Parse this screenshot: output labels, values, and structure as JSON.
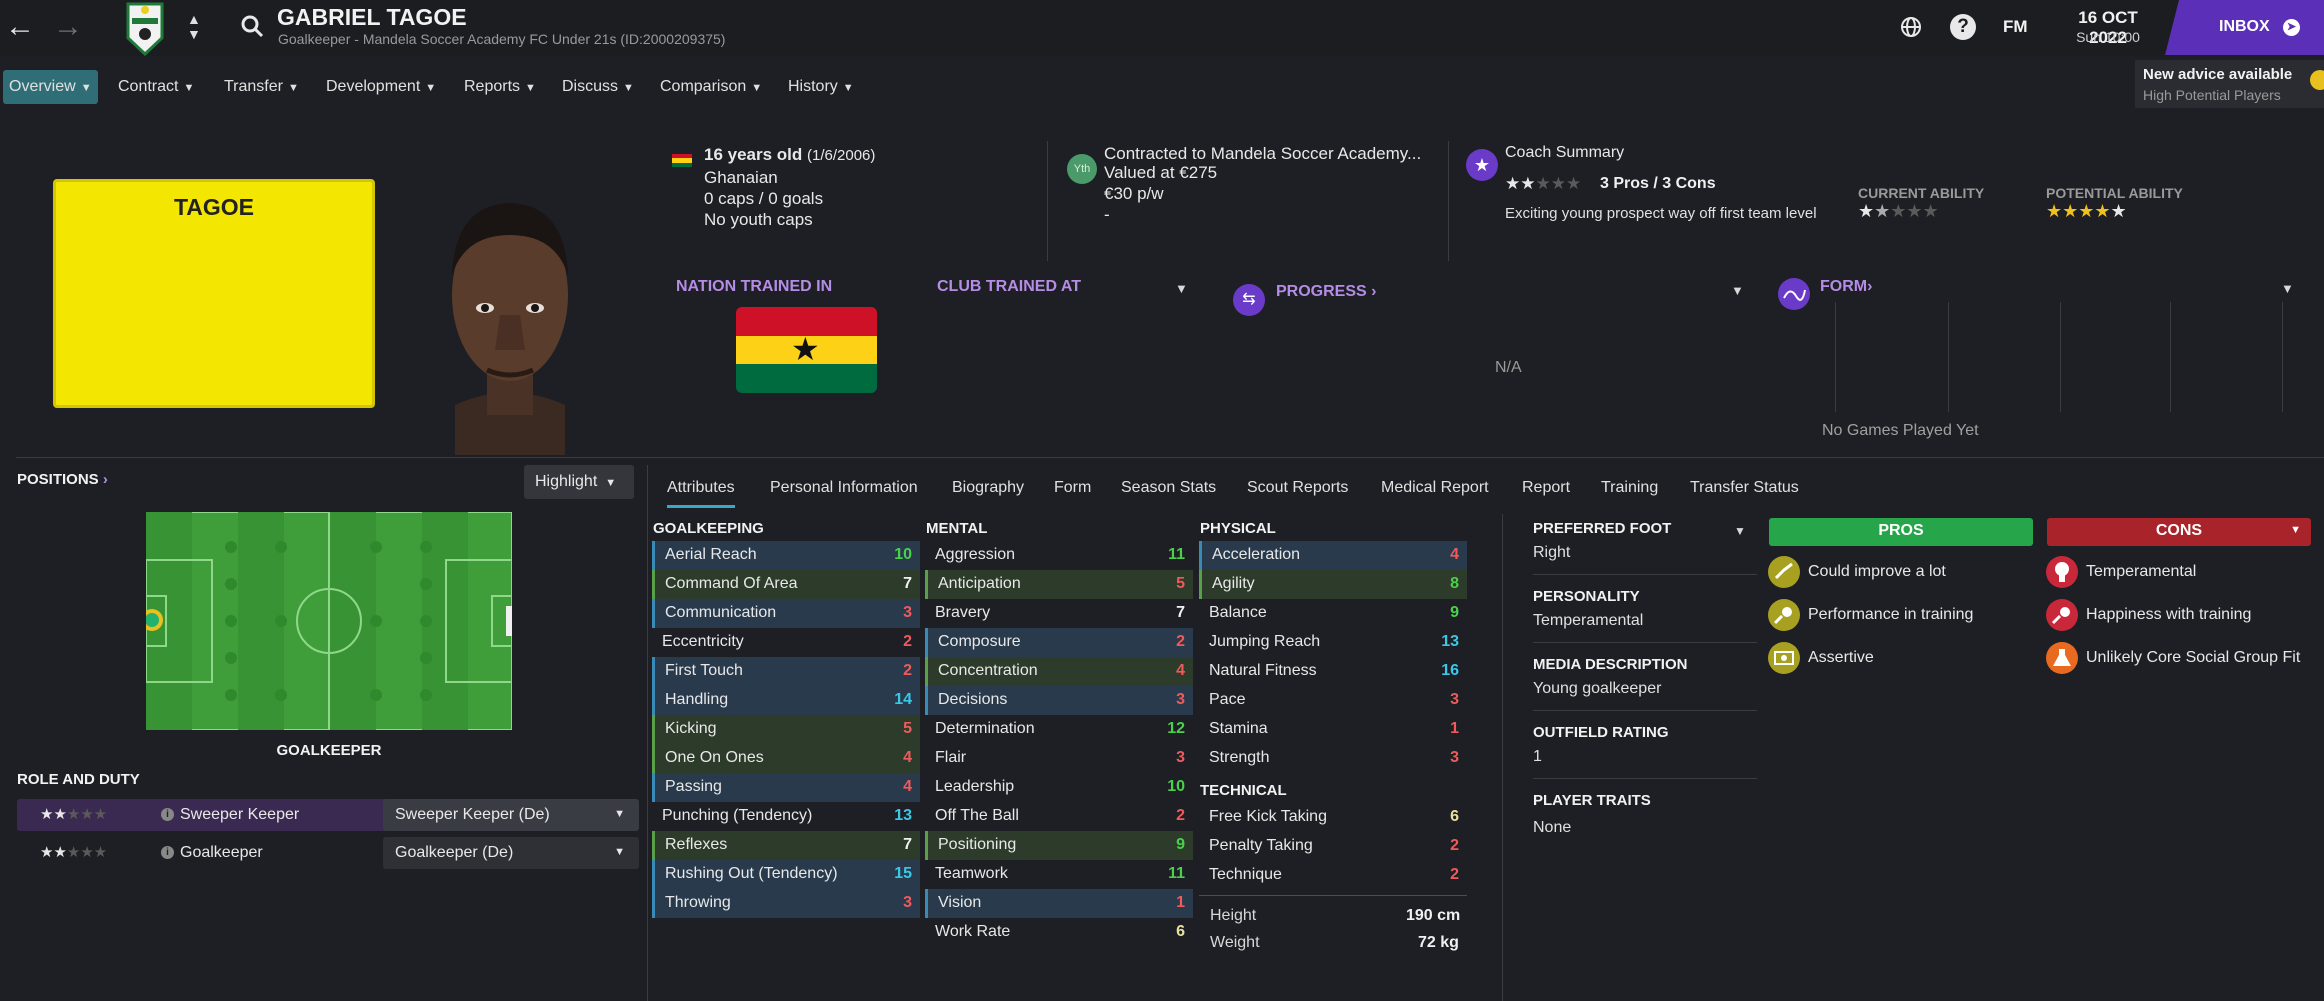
{
  "header": {
    "name": "GABRIEL TAGOE",
    "subtitle": "Goalkeeper - Mandela Soccer Academy FC Under 21s (ID:2000209375)",
    "date": "16 OCT 2022",
    "time": "Sun 10:00",
    "fm_label": "FM",
    "inbox_label": "INBOX",
    "advice_title": "New advice available",
    "advice_sub": "High Potential Players"
  },
  "nav": [
    "Overview",
    "Contract",
    "Transfer",
    "Development",
    "Reports",
    "Discuss",
    "Comparison",
    "History"
  ],
  "kit": {
    "name": "TAGOE"
  },
  "bio": {
    "age": "16 years old",
    "dob": "(1/6/2006)",
    "nationality": "Ghanaian",
    "caps": "0 caps / 0 goals",
    "youth_caps": "No youth caps"
  },
  "contract": {
    "badge": "Yth",
    "line1": "Contracted to Mandela Soccer Academy...",
    "line2": "Valued at €275",
    "line3": "€30 p/w",
    "line4": "-"
  },
  "coach": {
    "title": "Coach Summary",
    "pros_cons": "3 Pros / 3 Cons",
    "summary": "Exciting young prospect way off first team level",
    "stars": 2,
    "current_ability_label": "CURRENT ABILITY",
    "potential_ability_label": "POTENTIAL ABILITY",
    "current_ability": 1.5,
    "potential_ability": 4.5
  },
  "sections": {
    "nation_trained": "NATION TRAINED IN",
    "club_trained": "CLUB TRAINED AT",
    "progress": "PROGRESS",
    "progress_value": "N/A",
    "form": "FORM",
    "form_value": "No Games Played Yet"
  },
  "positions": {
    "label": "POSITIONS",
    "highlight": "Highlight",
    "position_name": "GOALKEEPER",
    "role_duty_label": "ROLE AND DUTY",
    "roles": [
      {
        "name": "Sweeper Keeper",
        "duty": "Sweeper Keeper (De)",
        "stars": 2
      },
      {
        "name": "Goalkeeper",
        "duty": "Goalkeeper (De)",
        "stars": 2
      }
    ]
  },
  "tabs": [
    "Attributes",
    "Personal Information",
    "Biography",
    "Form",
    "Season Stats",
    "Scout Reports",
    "Medical Report",
    "Report",
    "Training",
    "Transfer Status"
  ],
  "attributes": {
    "goalkeeping_label": "GOALKEEPING",
    "mental_label": "MENTAL",
    "physical_label": "PHYSICAL",
    "technical_label": "TECHNICAL",
    "goalkeeping": [
      {
        "name": "Aerial Reach",
        "value": "10",
        "hl": "b"
      },
      {
        "name": "Command Of Area",
        "value": "7",
        "hl": "g"
      },
      {
        "name": "Communication",
        "value": "3",
        "hl": "b"
      },
      {
        "name": "Eccentricity",
        "value": "2",
        "hl": ""
      },
      {
        "name": "First Touch",
        "value": "2",
        "hl": "b"
      },
      {
        "name": "Handling",
        "value": "14",
        "hl": "b"
      },
      {
        "name": "Kicking",
        "value": "5",
        "hl": "g"
      },
      {
        "name": "One On Ones",
        "value": "4",
        "hl": "g"
      },
      {
        "name": "Passing",
        "value": "4",
        "hl": "b"
      },
      {
        "name": "Punching (Tendency)",
        "value": "13",
        "hl": ""
      },
      {
        "name": "Reflexes",
        "value": "7",
        "hl": "g"
      },
      {
        "name": "Rushing Out (Tendency)",
        "value": "15",
        "hl": "b"
      },
      {
        "name": "Throwing",
        "value": "3",
        "hl": "b"
      }
    ],
    "mental": [
      {
        "name": "Aggression",
        "value": "11",
        "hl": ""
      },
      {
        "name": "Anticipation",
        "value": "5",
        "hl": "g"
      },
      {
        "name": "Bravery",
        "value": "7",
        "hl": ""
      },
      {
        "name": "Composure",
        "value": "2",
        "hl": "b"
      },
      {
        "name": "Concentration",
        "value": "4",
        "hl": "g"
      },
      {
        "name": "Decisions",
        "value": "3",
        "hl": "b"
      },
      {
        "name": "Determination",
        "value": "12",
        "hl": ""
      },
      {
        "name": "Flair",
        "value": "3",
        "hl": ""
      },
      {
        "name": "Leadership",
        "value": "10",
        "hl": ""
      },
      {
        "name": "Off The Ball",
        "value": "2",
        "hl": ""
      },
      {
        "name": "Positioning",
        "value": "9",
        "hl": "g"
      },
      {
        "name": "Teamwork",
        "value": "11",
        "hl": ""
      },
      {
        "name": "Vision",
        "value": "1",
        "hl": "b"
      },
      {
        "name": "Work Rate",
        "value": "6",
        "hl": ""
      }
    ],
    "physical": [
      {
        "name": "Acceleration",
        "value": "4",
        "hl": "b"
      },
      {
        "name": "Agility",
        "value": "8",
        "hl": "g"
      },
      {
        "name": "Balance",
        "value": "9",
        "hl": ""
      },
      {
        "name": "Jumping Reach",
        "value": "13",
        "hl": ""
      },
      {
        "name": "Natural Fitness",
        "value": "16",
        "hl": ""
      },
      {
        "name": "Pace",
        "value": "3",
        "hl": ""
      },
      {
        "name": "Stamina",
        "value": "1",
        "hl": ""
      },
      {
        "name": "Strength",
        "value": "3",
        "hl": ""
      }
    ],
    "technical": [
      {
        "name": "Free Kick Taking",
        "value": "6",
        "hl": ""
      },
      {
        "name": "Penalty Taking",
        "value": "2",
        "hl": ""
      },
      {
        "name": "Technique",
        "value": "2",
        "hl": ""
      }
    ],
    "height_label": "Height",
    "height": "190 cm",
    "weight_label": "Weight",
    "weight": "72 kg"
  },
  "details": {
    "foot_label": "PREFERRED FOOT",
    "foot": "Right",
    "personality_label": "PERSONALITY",
    "personality": "Temperamental",
    "media_label": "MEDIA DESCRIPTION",
    "media": "Young goalkeeper",
    "outfield_label": "OUTFIELD RATING",
    "outfield": "1",
    "traits_label": "PLAYER TRAITS",
    "traits": "None"
  },
  "pros_cons": {
    "pros_label": "PROS",
    "cons_label": "CONS",
    "pros": [
      "Could improve a lot",
      "Performance in training",
      "Assertive"
    ],
    "cons": [
      "Temperamental",
      "Happiness with training",
      "Unlikely Core Social Group Fit"
    ]
  },
  "colors": {
    "accent": "#5b2fb8",
    "pros": "#27a54a",
    "cons": "#a8232a",
    "pitch": "#3f9e3a",
    "value_red": "#f05a5a",
    "value_white": "#f0f0f0",
    "value_green": "#4ad04a",
    "value_cyan": "#3ac8e8",
    "value_yellow": "#e8e0a0"
  }
}
